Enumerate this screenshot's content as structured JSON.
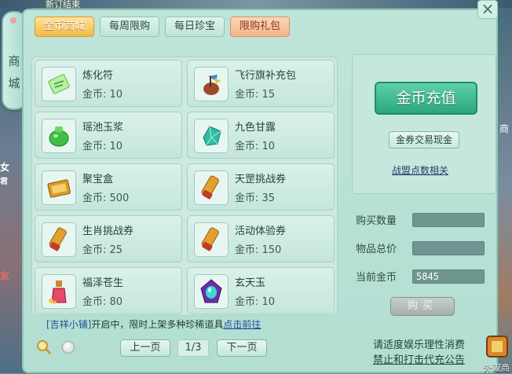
{
  "background": {
    "top_text": "新订结束",
    "left_text_1": "女",
    "left_text_2": "君",
    "left_text_3": "友",
    "right_text": "外观商",
    "right_side_text": "商"
  },
  "side_tab": {
    "label": "商城"
  },
  "tabs": [
    {
      "label": "金币商城",
      "active": true
    },
    {
      "label": "每周限购",
      "active": false
    },
    {
      "label": "每日珍宝",
      "active": false
    },
    {
      "label": "限购礼包",
      "active": false
    }
  ],
  "items": [
    {
      "name": "炼化符",
      "price": "金币: 10",
      "icon": "talisman-icon"
    },
    {
      "name": "飞行旗补充包",
      "price": "金币: 15",
      "icon": "flag-pack-icon"
    },
    {
      "name": "瑶池玉浆",
      "price": "金币: 10",
      "icon": "jade-jar-icon"
    },
    {
      "name": "九色甘露",
      "price": "金币: 10",
      "icon": "gem-icon"
    },
    {
      "name": "聚宝盒",
      "price": "金币: 500",
      "icon": "treasure-box-icon"
    },
    {
      "name": "天罡挑战券",
      "price": "金币: 35",
      "icon": "scroll-icon"
    },
    {
      "name": "生肖挑战券",
      "price": "金币: 25",
      "icon": "scroll-icon"
    },
    {
      "name": "活动体验券",
      "price": "金币: 150",
      "icon": "scroll-icon"
    },
    {
      "name": "福泽苍生",
      "price": "金币: 80",
      "icon": "potion-icon"
    },
    {
      "name": "玄天玉",
      "price": "金币: 10",
      "icon": "purple-jade-icon"
    }
  ],
  "right": {
    "recharge_label": "金币充值",
    "trade_label": "金券交易现金",
    "alliance_link": "战盟点数相关",
    "buy_qty_label": "购买数量",
    "buy_qty_value": "",
    "total_label": "物品总价",
    "total_value": "",
    "current_label": "当前金币",
    "current_value": "5845",
    "buy_label": "购买"
  },
  "bottom": {
    "notice_bracket": "[吉祥小铺]",
    "notice_text": "开启中，限时上架多种珍稀道具",
    "notice_link": "点击前往",
    "prev_label": "上一页",
    "page": "1/3",
    "next_label": "下一页",
    "warn_1": "请适度娱乐理性消费",
    "warn_2": "禁止和打击代充公告"
  },
  "colors": {
    "panel": "#bfe5da",
    "active_tab": "#f2b947",
    "recharge": "#2aa67d",
    "link": "#1e4f9b"
  }
}
